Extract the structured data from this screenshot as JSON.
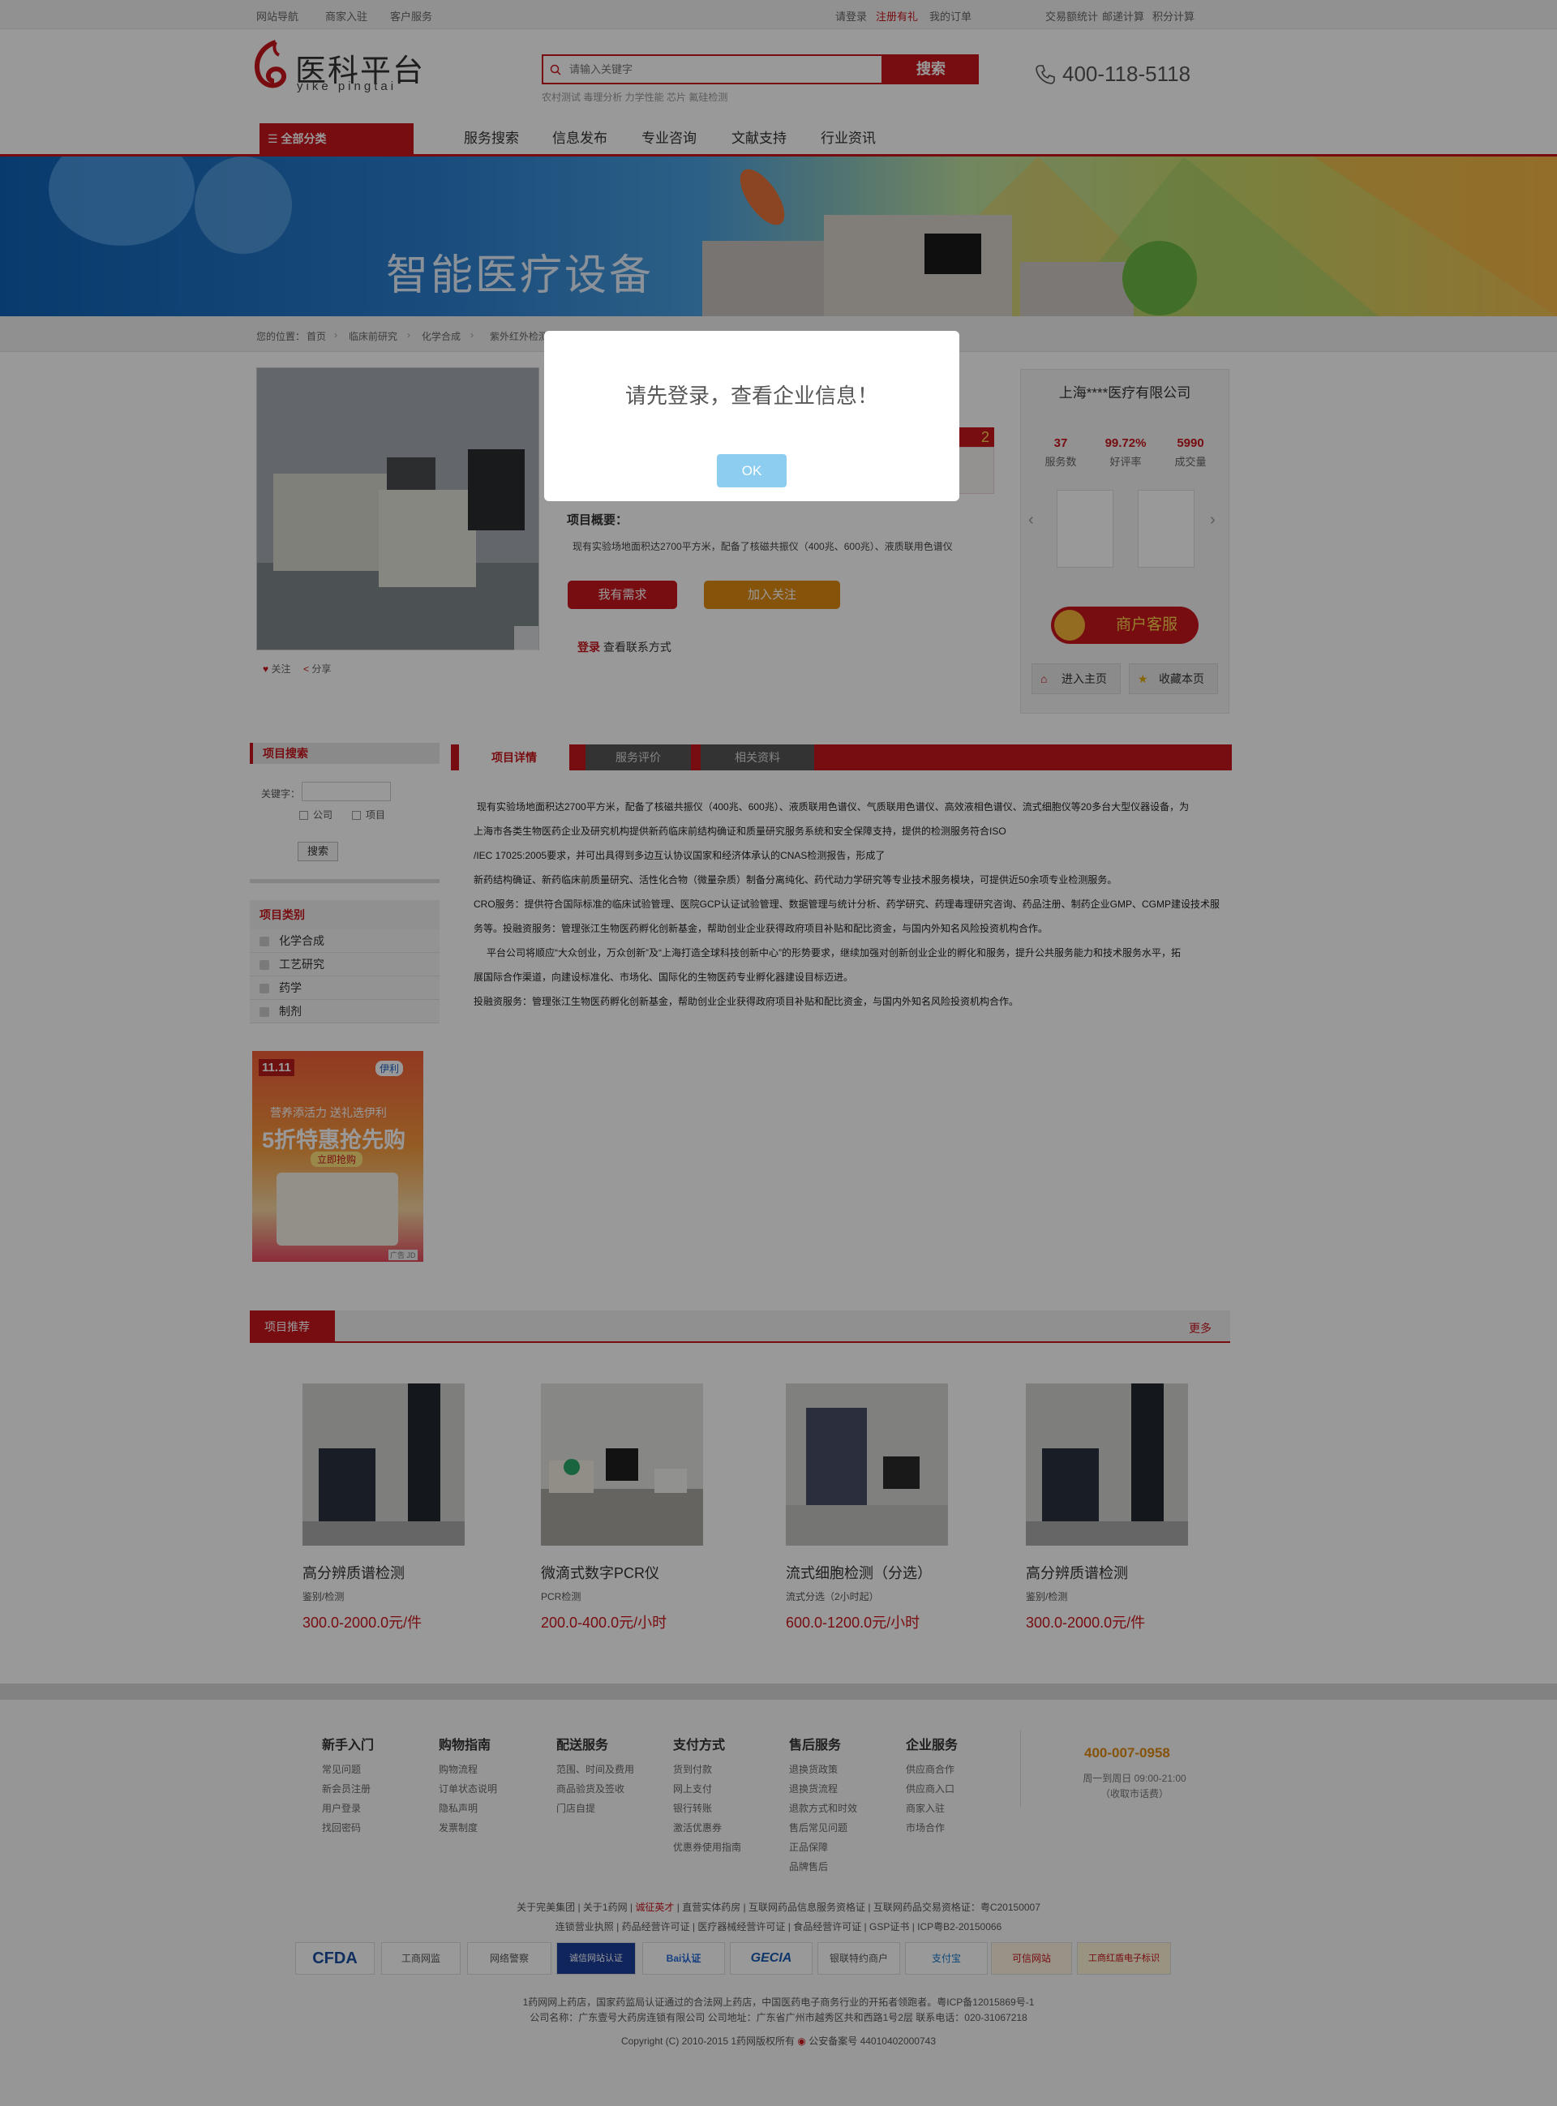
{
  "topbar": {
    "site_nav": "网站导航",
    "merchant": "商家入驻",
    "service": "客户服务",
    "login": "请登录",
    "register": "注册有礼",
    "orders": "我的订单",
    "stat1": "交易额统计",
    "stat2": "邮递计算",
    "stat3": "积分计算"
  },
  "logo": {
    "cn": "医科平台",
    "en": "yike pingtai"
  },
  "search": {
    "placeholder": "请输入关键字",
    "button": "搜索",
    "hot": "农村测试 毒理分析 力学性能 芯片 氟硅检测"
  },
  "hotline": "400-118-5118",
  "nav": {
    "all": "全部分类",
    "items": [
      "服务搜索",
      "信息发布",
      "专业咨询",
      "文献支持",
      "行业资讯"
    ]
  },
  "banner": {
    "title": "智能医疗设备"
  },
  "breadcrumb": {
    "prefix": "您的位置：",
    "items": [
      "首页",
      "临床前研究",
      "化学合成",
      "紫外红外检测"
    ]
  },
  "product": {
    "price_fragment": "2",
    "follow": "关注",
    "share": "分享",
    "overview_label": "项目概要：",
    "overview_text": "现有实验场地面积达2700平方米，配备了核磁共振仪（400兆、600兆）、液质联用色谱仪",
    "need_btn": "我有需求",
    "follow_btn": "加入关注",
    "login_word": "登录",
    "login_rest": "查看联系方式"
  },
  "company": {
    "name": "上海****医疗有限公司",
    "stats": [
      {
        "num": "37",
        "label": "服务数"
      },
      {
        "num": "99.72%",
        "label": "好评率"
      },
      {
        "num": "5990",
        "label": "成交量"
      }
    ],
    "cs": "商户客服",
    "home": "进入主页",
    "fav": "收藏本页"
  },
  "sidebar": {
    "search_title": "项目搜索",
    "kw": "关键字：",
    "opt_company": "公司",
    "opt_project": "项目",
    "search_btn": "搜索",
    "cat_title": "项目类别",
    "cats": [
      "化学合成",
      "工艺研究",
      "药学",
      "制剂"
    ]
  },
  "ad": {
    "badge": "11.11",
    "brand": "伊利",
    "line1": "营养添活力 送礼选伊利",
    "line2": "5折特惠抢先购",
    "btn": "立即抢购",
    "corner": "广告 JD"
  },
  "tabs": [
    "项目详情",
    "服务评价",
    "相关资料"
  ],
  "detail_lines": [
    "现有实验场地面积达2700平方米，配备了核磁共振仪（400兆、600兆）、液质联用色谱仪、气质联用色谱仪、高效液相色谱仪、流式细胞仪等20多台大型仪器设备，为",
    "上海市各类生物医药企业及研究机构提供新药临床前结构确证和质量研究服务系统和安全保障支持，提供的检测服务符合ISO",
    "/IEC 17025:2005要求，并可出具得到多边互认协议国家和经济体承认的CNAS检测报告，形成了",
    "新药结构确证、新药临床前质量研究、活性化合物（微量杂质）制备分离纯化、药代动力学研究等专业技术服务模块，可提供近50余项专业检测服务。",
    "CRO服务：提供符合国际标准的临床试验管理、医院GCP认证试验管理、数据管理与统计分析、药学研究、药理毒理研究咨询、药品注册、制药企业GMP、CGMP建设技术服",
    "务等。投融资服务：管理张江生物医药孵化创新基金，帮助创业企业获得政府项目补贴和配比资金，与国内外知名风险投资机构合作。",
    "平台公司将顺应“大众创业，万众创新”及“上海打造全球科技创新中心”的形势要求，继续加强对创新创业企业的孵化和服务，提升公共服务能力和技术服务水平，拓",
    "展国际合作渠道，向建设标准化、市场化、国际化的生物医药专业孵化器建设目标迈进。",
    "投融资服务：管理张江生物医药孵化创新基金，帮助创业企业获得政府项目补贴和配比资金，与国内外知名风险投资机构合作。"
  ],
  "recommend": {
    "title": "项目推荐",
    "more": "更多",
    "items": [
      {
        "name": "高分辨质谱检测",
        "sub": "鉴别/检测",
        "price": "300.0-2000.0元/件"
      },
      {
        "name": "微滴式数字PCR仪",
        "sub": "PCR检测",
        "price": "200.0-400.0元/小时"
      },
      {
        "name": "流式细胞检测（分选）",
        "sub": "流式分选（2小时起）",
        "price": "600.0-1200.0元/小时"
      },
      {
        "name": "高分辨质谱检测",
        "sub": "鉴别/检测",
        "price": "300.0-2000.0元/件"
      }
    ]
  },
  "footer": {
    "cols": [
      {
        "title": "新手入门",
        "links": [
          "常见问题",
          "新会员注册",
          "用户登录",
          "找回密码"
        ]
      },
      {
        "title": "购物指南",
        "links": [
          "购物流程",
          "订单状态说明",
          "隐私声明",
          "发票制度"
        ]
      },
      {
        "title": "配送服务",
        "links": [
          "范围、时间及费用",
          "商品验货及签收",
          "门店自提"
        ]
      },
      {
        "title": "支付方式",
        "links": [
          "货到付款",
          "网上支付",
          "银行转账",
          "激活优惠券",
          "优惠券使用指南"
        ]
      },
      {
        "title": "售后服务",
        "links": [
          "退换货政策",
          "退换货流程",
          "退款方式和时效",
          "售后常见问题",
          "正品保障",
          "品牌售后"
        ]
      },
      {
        "title": "企业服务",
        "links": [
          "供应商合作",
          "供应商入口",
          "商家入驻",
          "市场合作"
        ]
      }
    ],
    "phone": "400-007-0958",
    "hours": "周一到周日 09:00-21:00",
    "hours2": "（收取市话费）",
    "links1": [
      "关于完美集团",
      "关于1药网",
      "诚征英才",
      "直营实体药房",
      "互联网药品信息服务资格证",
      "互联网药品交易资格证：粤C20150007"
    ],
    "links2": [
      "连锁营业执照",
      "药品经营许可证",
      "医疗器械经营许可证",
      "食品经营许可证",
      "GSP证书",
      "ICP粤B2-20150066"
    ],
    "badges": [
      "CFDA",
      "工商网监",
      "网络警察",
      "诚信网站认证",
      "Bai认证",
      "GECIA",
      "银联特约商户",
      "支付宝",
      "可信网站",
      "工商红盾电子标识"
    ],
    "copy1": "1药网网上药店，国家药监局认证通过的合法网上药店，中国医药电子商务行业的开拓者领跑者。粤ICP备12015869号-1",
    "copy2": "公司名称：广东壹号大药房连锁有限公司 公司地址：广东省广州市越秀区共和西路1号2层 联系电话：020-31067218",
    "copy3": "Copyright (C) 2010-2015 1药网版权所有",
    "police": "公安备案号 44010402000743"
  },
  "modal": {
    "message": "请先登录，查看企业信息！",
    "ok": "OK"
  }
}
